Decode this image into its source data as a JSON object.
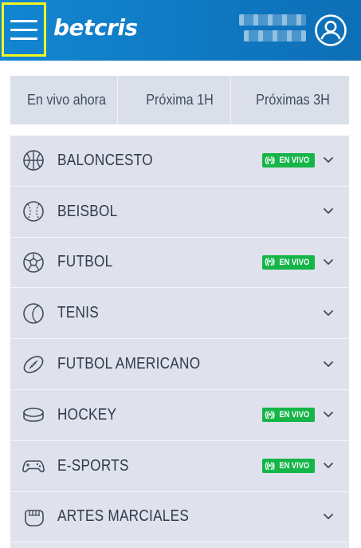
{
  "header": {
    "brand": "betcris",
    "colors": {
      "primary": "#1386d1",
      "highlight": "#f6f51d"
    },
    "menu_icon": "hamburger-icon",
    "account_icon": "user-icon"
  },
  "filters": [
    {
      "label": "En vivo ahora"
    },
    {
      "label": "Próxima 1H"
    },
    {
      "label": "Próximas 3H"
    }
  ],
  "live_label": "EN VIVO",
  "live_signal": "((•))",
  "live_color": "#15b548",
  "sports": [
    {
      "label": "BALONCESTO",
      "icon": "basketball-icon",
      "live": true
    },
    {
      "label": "BEISBOL",
      "icon": "baseball-icon",
      "live": false
    },
    {
      "label": "FUTBOL",
      "icon": "soccer-ball-icon",
      "live": true
    },
    {
      "label": "TENIS",
      "icon": "tennis-ball-icon",
      "live": false
    },
    {
      "label": "FUTBOL AMERICANO",
      "icon": "american-football-icon",
      "live": false
    },
    {
      "label": "HOCKEY",
      "icon": "hockey-puck-icon",
      "live": true
    },
    {
      "label": "E-SPORTS",
      "icon": "gamepad-icon",
      "live": true
    },
    {
      "label": "ARTES MARCIALES",
      "icon": "fist-icon",
      "live": false
    }
  ]
}
